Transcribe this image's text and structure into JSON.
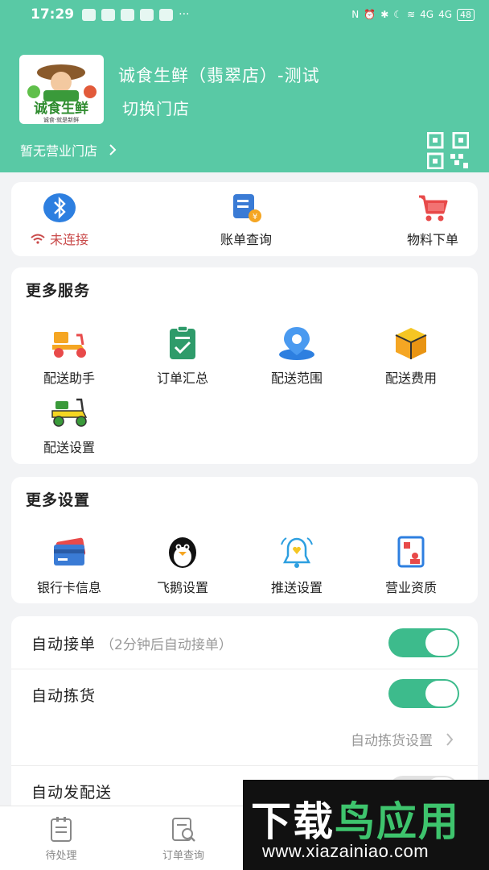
{
  "status_bar": {
    "time": "17:29",
    "more": "···",
    "signal1": "4G",
    "signal2": "4G",
    "battery": "48"
  },
  "header": {
    "logo": {
      "title": "诚食生鲜",
      "slogan": "诚食·就是新鲜"
    },
    "store_name": "诚食生鲜（翡翠店）-测试",
    "switch_store": "切换门店",
    "no_open_store": "暂无营业门店",
    "icons": [
      "qr-code-icon",
      "chevron-right-icon"
    ]
  },
  "quick_actions": [
    {
      "label": "未连接",
      "icon": "bluetooth-icon",
      "status_color": "#c94a4a"
    },
    {
      "label": "账单查询",
      "icon": "bill-icon"
    },
    {
      "label": "物料下单",
      "icon": "cart-icon"
    }
  ],
  "services": {
    "title": "更多服务",
    "items": [
      {
        "label": "配送助手",
        "icon": "delivery-scooter-icon"
      },
      {
        "label": "订单汇总",
        "icon": "clipboard-check-icon"
      },
      {
        "label": "配送范围",
        "icon": "location-pin-icon"
      },
      {
        "label": "配送费用",
        "icon": "box-icon"
      },
      {
        "label": "配送设置",
        "icon": "scooter-settings-icon"
      }
    ]
  },
  "settings": {
    "title": "更多设置",
    "items": [
      {
        "label": "银行卡信息",
        "icon": "bank-card-icon"
      },
      {
        "label": "飞鹅设置",
        "icon": "penguin-icon"
      },
      {
        "label": "推送设置",
        "icon": "bell-icon"
      },
      {
        "label": "营业资质",
        "icon": "license-icon"
      }
    ]
  },
  "toggles": {
    "auto_accept": {
      "label": "自动接单",
      "hint": "（2分钟后自动接单）",
      "on": true
    },
    "auto_pick": {
      "label": "自动拣货",
      "on": true,
      "sub_link": "自动拣货设置"
    },
    "auto_dispatch": {
      "label": "自动发配送",
      "on": false
    }
  },
  "tabbar": [
    {
      "label": "待处理",
      "icon": "pending-list-icon"
    },
    {
      "label": "订单查询",
      "icon": "order-search-icon"
    }
  ],
  "watermark": {
    "title_part1": "下载",
    "title_part2": "鸟应用",
    "url": "www.xiazainiao.com"
  },
  "colors": {
    "primary": "#59c9a5",
    "switch_on": "#3dbb8c",
    "orange": "#f5a623",
    "blue": "#3a7bd5",
    "red": "#e84a4a"
  }
}
